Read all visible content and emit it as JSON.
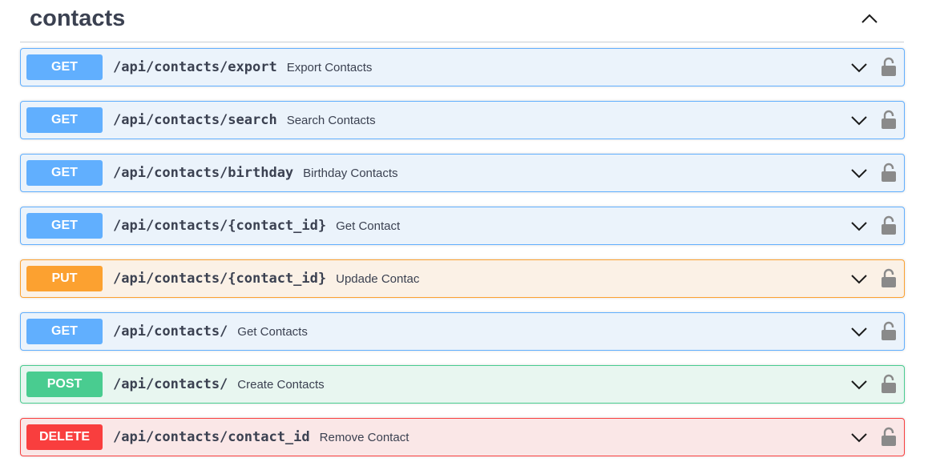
{
  "tag": {
    "title": "contacts"
  },
  "operations": [
    {
      "method": "GET",
      "path": "/api/contacts/export",
      "summary": "Export Contacts"
    },
    {
      "method": "GET",
      "path": "/api/contacts/search",
      "summary": "Search Contacts"
    },
    {
      "method": "GET",
      "path": "/api/contacts/birthday",
      "summary": "Birthday Contacts"
    },
    {
      "method": "GET",
      "path": "/api/contacts/{contact_id}",
      "summary": "Get Contact"
    },
    {
      "method": "PUT",
      "path": "/api/contacts/{contact_id}",
      "summary": "Updade Contac"
    },
    {
      "method": "GET",
      "path": "/api/contacts/",
      "summary": "Get Contacts"
    },
    {
      "method": "POST",
      "path": "/api/contacts/",
      "summary": "Create Contacts"
    },
    {
      "method": "DELETE",
      "path": "/api/contacts/contact_id",
      "summary": "Remove Contact"
    }
  ],
  "colors": {
    "get": "#61affe",
    "put": "#fca130",
    "post": "#49cc90",
    "delete": "#f93e3e",
    "text": "#3b4151"
  },
  "icons": {
    "collapse": "chevron-up-icon",
    "expand": "chevron-down-icon",
    "authorization": "unlocked-padlock-icon"
  }
}
